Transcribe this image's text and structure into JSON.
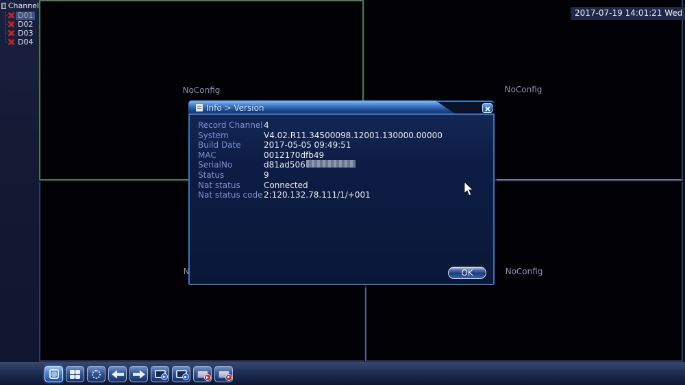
{
  "clock": {
    "text": "2017-07-19 14:01:21 Wed"
  },
  "channel_panel": {
    "title": "Channel",
    "items": [
      {
        "label": "D01",
        "selected": true
      },
      {
        "label": "D02",
        "selected": false
      },
      {
        "label": "D03",
        "selected": false
      },
      {
        "label": "D04",
        "selected": false
      }
    ]
  },
  "video_grid": {
    "overlay_label": "NoConfig",
    "selected_quadrant": "top-left"
  },
  "dialog": {
    "title": "Info > Version",
    "fields": [
      {
        "label": "Record Channel",
        "value": "4",
        "redacted": false
      },
      {
        "label": "System",
        "value": "V4.02.R11.34500098.12001.130000.00000",
        "redacted": false
      },
      {
        "label": "Build Date",
        "value": "2017-05-05 09:49:51",
        "redacted": false
      },
      {
        "label": "MAC",
        "value": "0012170dfb49",
        "redacted": false
      },
      {
        "label": "SerialNo",
        "value": "d81ad506",
        "redacted": true
      },
      {
        "label": "Status",
        "value": "9",
        "redacted": false
      },
      {
        "label": "Nat status",
        "value": "Connected",
        "redacted": false
      },
      {
        "label": "Nat status code",
        "value": "2:120.132.78.111/1/+001",
        "redacted": false
      }
    ],
    "ok_label": "OK"
  },
  "toolbar": {
    "buttons": [
      {
        "name": "single-screen-button",
        "icon": "single-screen-icon",
        "active": true
      },
      {
        "name": "quad-screen-button",
        "icon": "quad-screen-icon",
        "active": false
      },
      {
        "name": "tour-button",
        "icon": "tour-icon",
        "active": false
      },
      {
        "name": "prev-channel-button",
        "icon": "arrow-left-icon",
        "active": false
      },
      {
        "name": "next-channel-button",
        "icon": "arrow-right-icon",
        "active": false
      },
      {
        "name": "monitor-play-button",
        "icon": "monitor-play-icon",
        "active": false
      },
      {
        "name": "monitor-record-button",
        "icon": "monitor-record-icon",
        "active": false
      },
      {
        "name": "playback-button",
        "icon": "file-play-icon",
        "active": false
      },
      {
        "name": "record-button",
        "icon": "file-record-icon",
        "active": false
      }
    ]
  },
  "colors": {
    "selected_border_green": "#4d7a52",
    "divider_gray": "#75799a",
    "accent_blue": "#3b78c8",
    "alarm_red": "#c62222",
    "dialog_bg": "#0c1c44"
  }
}
